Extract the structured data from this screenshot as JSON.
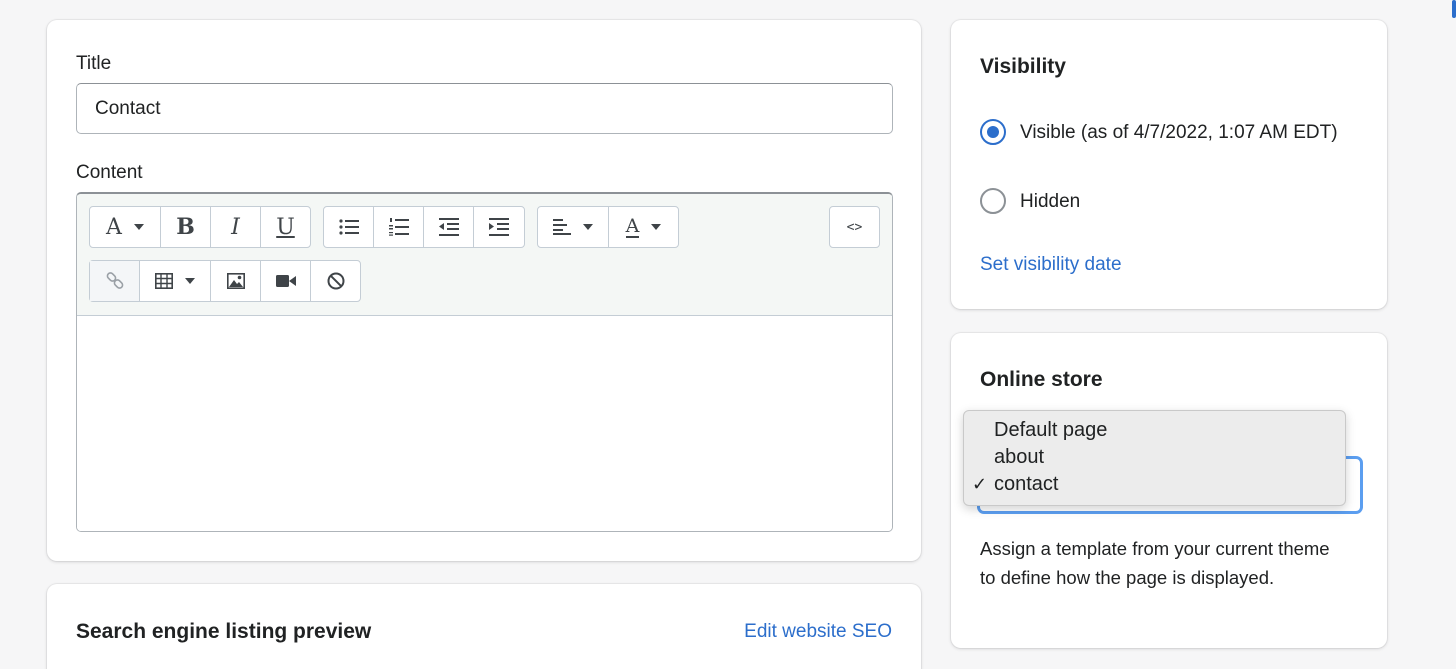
{
  "main_card": {
    "title_label": "Title",
    "title_value": "Contact",
    "content_label": "Content",
    "toolbar": {
      "row1": [
        "font-icon",
        "bold-icon",
        "italic-icon",
        "underline-icon",
        "bullet-list-icon",
        "numbered-list-icon",
        "outdent-icon",
        "indent-icon",
        "align-left-icon",
        "text-color-icon",
        "html-code-icon"
      ],
      "row2": [
        "link-icon",
        "table-icon",
        "image-icon",
        "video-icon",
        "clear-format-icon"
      ],
      "glyphs": {
        "font": "A",
        "bold": "B",
        "italic": "I",
        "underline": "U",
        "text_color": "A",
        "code": "<>"
      }
    }
  },
  "seo_card": {
    "heading": "Search engine listing preview",
    "edit_link": "Edit website SEO"
  },
  "visibility_card": {
    "heading": "Visibility",
    "options": [
      {
        "label": "Visible (as of 4/7/2022, 1:07 AM EDT)",
        "checked": true
      },
      {
        "label": "Hidden",
        "checked": false
      }
    ],
    "set_date_link": "Set visibility date"
  },
  "online_store_card": {
    "heading": "Online store",
    "template_options": [
      "Default page",
      "about",
      "contact"
    ],
    "selected": "contact",
    "check_mark": "✓",
    "help_text": "Assign a template from your current theme to define how the page is displayed."
  },
  "colors": {
    "accent": "#2c6ecb",
    "focus_ring": "#5b9ef0",
    "background": "#f6f6f7"
  }
}
